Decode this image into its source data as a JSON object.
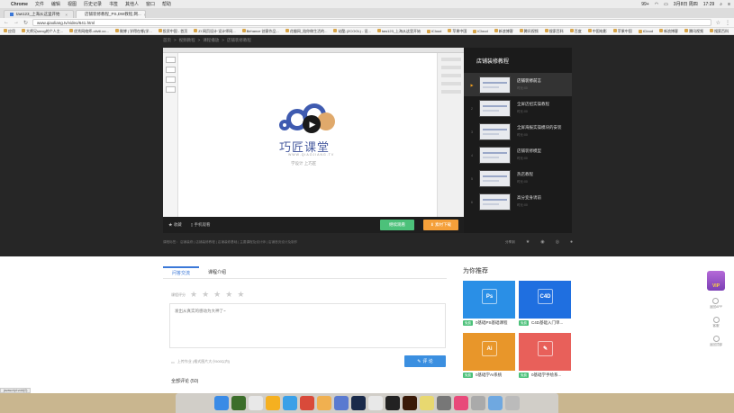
{
  "menubar": {
    "app_name": "Chrome",
    "items": [
      "文件",
      "编辑",
      "视图",
      "历史记录",
      "书签",
      "其他人",
      "窗口",
      "帮助"
    ],
    "status_items": [
      "99+",
      "3月8日 周四",
      "17:29"
    ]
  },
  "tabs": [
    {
      "title": "taw123_上海从这里开始"
    },
    {
      "title": "店铺装修教程_PS,DW教程,网..."
    }
  ],
  "address": {
    "url": "www.qiaoliang.tv/video/641.html"
  },
  "bookmarks": [
    "应用",
    "大师兄snrcg的个人主...",
    "优秀网络师-oliviii.co...",
    "微博 | 学得在哪(学...",
    "投资中国 - 首页",
    "ZI 网页设计·设计师网...",
    "Behance 创意作品...",
    "花瓣网_陪你做生活的...",
    "站酷 (ZCOOL) - 设...",
    "taw123_上海从这里开始",
    "iCloud",
    "苹果中国",
    "iCloud",
    "新浪博客",
    "腾讯视频",
    "搜索百科",
    "百度",
    "中国电影",
    "苹果中国",
    "iCloud",
    "新浪博客",
    "腾讯视频",
    "搜索百科",
    "百度",
    "中国电影"
  ],
  "breadcrumb": [
    "首页",
    "视频教程",
    "课程播放",
    "店铺装修教程"
  ],
  "player": {
    "logo_text": "巧匠课堂",
    "logo_sub": "WWW.QIAOJIANG.TV",
    "tagline": "学设计 上巧匠"
  },
  "controls": {
    "favorite": "收藏",
    "mobile": "手机观看",
    "learn_btn": "继续观看",
    "download_btn": "素材下载"
  },
  "under_links": {
    "text": "课程标签：   店铺装修   |   店铺装修教程   |   店铺装修基础   |   主要课程及设计师   |   店铺首页设计及制作",
    "meta_label": "分享到"
  },
  "playlist": {
    "title": "店铺装修教程",
    "items": [
      {
        "name": "店铺装修前言",
        "time": "时长:00",
        "active": true
      },
      {
        "name": "全屏店招实操教程",
        "time": "时长:00"
      },
      {
        "name": "全屏海报实操模块的安装",
        "time": "时长:00"
      },
      {
        "name": "店铺装修模型",
        "time": "时长:00"
      },
      {
        "name": "热店教程",
        "time": "时长:00"
      },
      {
        "name": "高分变身诱前",
        "time": "时长:00"
      }
    ]
  },
  "content_tabs": [
    "问答交流",
    "课程介绍"
  ],
  "rating_label": "课程评分",
  "comment_placeholder": "发出从真实的感动为大神了~",
  "upload_label": "上传作业  (格式图片大小500以内)",
  "submit_label": "评 论",
  "all_comments": "全部评论 (50)",
  "recommend": {
    "title": "为你推荐",
    "cards": [
      {
        "badge": "免费",
        "label": "0基础PS基础课程",
        "color": "#2a8fe6",
        "icon": "Ps"
      },
      {
        "badge": "免费",
        "label": "C4D基础入门单...",
        "color": "#1f6fe0",
        "icon": "C4D"
      },
      {
        "badge": "免费",
        "label": "0基础学AI系统",
        "color": "#e8962a",
        "icon": "Ai"
      },
      {
        "badge": "免费",
        "label": "0基础学手绘系...",
        "color": "#e8605a",
        "icon": "✎"
      }
    ]
  },
  "side": {
    "vip": "VIP",
    "items": [
      "返回APP",
      "客服",
      "返回顶部"
    ]
  },
  "status_bar": "javascript:void(0)",
  "dock": [
    "Finder",
    "Dw",
    "Chrome",
    "Sketch",
    "Safari",
    "Weibo",
    "Photo",
    "Qiao",
    "Ps",
    "Mail",
    "QQ",
    "Ai",
    "Notes",
    "Settings",
    "Music",
    "Trash",
    "Download",
    "Trash2"
  ]
}
